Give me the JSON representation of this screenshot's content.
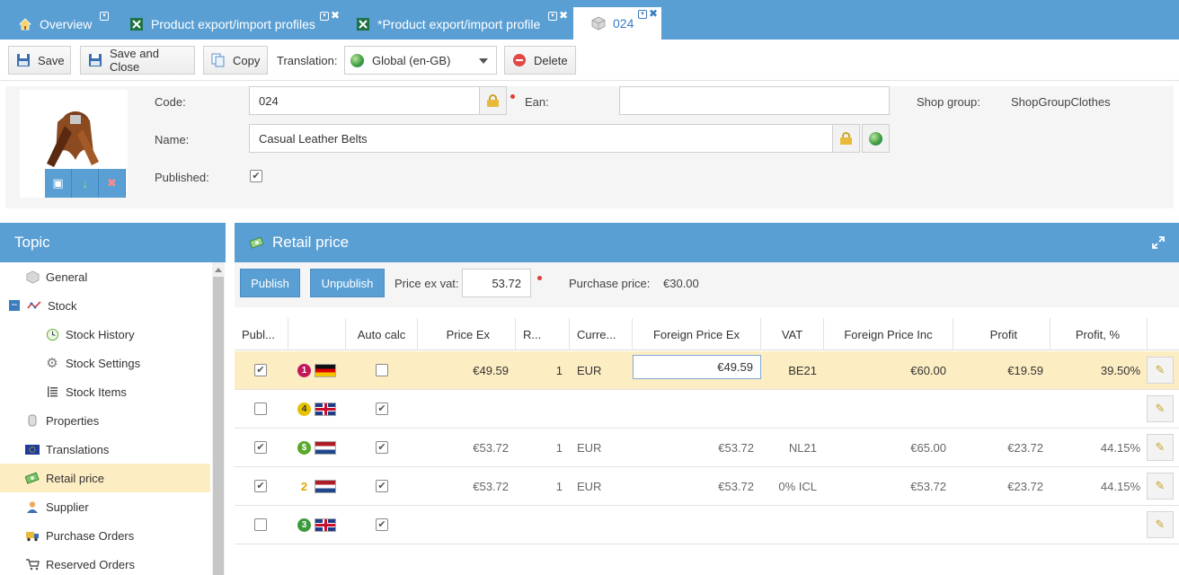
{
  "tabs": [
    {
      "label": "Overview",
      "icon": "home-icon"
    },
    {
      "label": "Product export/import profiles",
      "icon": "excel-icon"
    },
    {
      "label": "*Product export/import profile",
      "icon": "excel-icon"
    },
    {
      "label": "024",
      "icon": "cube-icon",
      "active": true
    }
  ],
  "toolbar": {
    "save": "Save",
    "save_close": "Save and Close",
    "copy": "Copy",
    "translation_label": "Translation:",
    "translation_value": "Global (en-GB)",
    "delete": "Delete"
  },
  "form": {
    "code_label": "Code:",
    "code_value": "024",
    "ean_label": "Ean:",
    "ean_value": "",
    "shop_group_label": "Shop group:",
    "shop_group_value": "ShopGroupClothes",
    "name_label": "Name:",
    "name_value": "Casual Leather Belts",
    "published_label": "Published:",
    "published": true
  },
  "topic": {
    "title": "Topic",
    "items": [
      {
        "label": "General",
        "icon": "cube-icon",
        "indent": 0
      },
      {
        "label": "Stock",
        "icon": "chart-icon",
        "indent": 0,
        "expanded": true
      },
      {
        "label": "Stock History",
        "icon": "history-icon",
        "indent": 1
      },
      {
        "label": "Stock Settings",
        "icon": "gear-icon",
        "indent": 1
      },
      {
        "label": "Stock Items",
        "icon": "list-icon",
        "indent": 1
      },
      {
        "label": "Properties",
        "icon": "properties-icon",
        "indent": 0
      },
      {
        "label": "Translations",
        "icon": "eu-flag-icon",
        "indent": 0
      },
      {
        "label": "Retail price",
        "icon": "money-icon",
        "indent": 0,
        "selected": true
      },
      {
        "label": "Supplier",
        "icon": "person-icon",
        "indent": 0
      },
      {
        "label": "Purchase Orders",
        "icon": "truck-icon",
        "indent": 0
      },
      {
        "label": "Reserved Orders",
        "icon": "cart-icon",
        "indent": 0
      }
    ]
  },
  "retail": {
    "title": "Retail price",
    "publish": "Publish",
    "unpublish": "Unpublish",
    "price_ex_vat_label": "Price ex vat:",
    "price_ex_vat_value": "53.72",
    "purchase_price_label": "Purchase price:",
    "purchase_price_value": "€30.00",
    "columns": [
      "Publ...",
      "",
      "Auto calc",
      "Price Ex",
      "R...",
      "Curre...",
      "Foreign Price Ex",
      "VAT",
      "Foreign Price Inc",
      "Profit",
      "Profit, %"
    ],
    "rows": [
      {
        "published": true,
        "badge": "1",
        "badge_color": "#c2185b",
        "flag": "de",
        "auto_calc": false,
        "price_ex": "€49.59",
        "rate": "1",
        "currency": "EUR",
        "foreign_price_ex": "€49.59",
        "vat": "BE21",
        "foreign_price_inc": "€60.00",
        "profit": "€19.59",
        "profit_pct": "39.50%",
        "highlight": true
      },
      {
        "published": false,
        "badge": "4",
        "badge_color": "#e6c200",
        "flag": "gb",
        "auto_calc": true,
        "price_ex": "",
        "rate": "",
        "currency": "",
        "foreign_price_ex": "",
        "vat": "",
        "foreign_price_inc": "",
        "profit": "",
        "profit_pct": ""
      },
      {
        "published": true,
        "badge": "$",
        "badge_color": "#5aa829",
        "flag": "nl",
        "auto_calc": true,
        "price_ex": "€53.72",
        "rate": "1",
        "currency": "EUR",
        "foreign_price_ex": "€53.72",
        "vat": "NL21",
        "foreign_price_inc": "€65.00",
        "profit": "€23.72",
        "profit_pct": "44.15%"
      },
      {
        "published": true,
        "badge": "2",
        "badge_color": "#f0c020",
        "flag": "nl",
        "auto_calc": true,
        "price_ex": "€53.72",
        "rate": "1",
        "currency": "EUR",
        "foreign_price_ex": "€53.72",
        "vat": "0% ICL",
        "foreign_price_inc": "€53.72",
        "profit": "€23.72",
        "profit_pct": "44.15%"
      },
      {
        "published": false,
        "badge": "3",
        "badge_color": "#3c9a3c",
        "flag": "gb",
        "auto_calc": true,
        "price_ex": "",
        "rate": "",
        "currency": "",
        "foreign_price_ex": "",
        "vat": "",
        "foreign_price_inc": "",
        "profit": "",
        "profit_pct": ""
      }
    ]
  }
}
